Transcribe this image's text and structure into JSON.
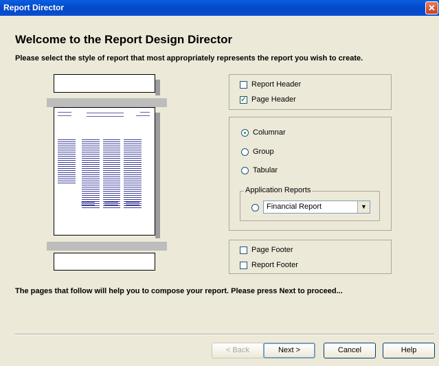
{
  "window": {
    "title": "Report Director",
    "close_icon": "close-icon"
  },
  "header": {
    "title": "Welcome to the Report Design Director",
    "subtitle": "Please select the style of report that most appropriately represents the report you wish to create."
  },
  "header_options": [
    {
      "label": "Report Header",
      "checked": false
    },
    {
      "label": "Page Header",
      "checked": true
    }
  ],
  "style_options": [
    {
      "label": "Columnar",
      "selected": true
    },
    {
      "label": "Group",
      "selected": false
    },
    {
      "label": "Tabular",
      "selected": false
    }
  ],
  "app_reports": {
    "legend": "Application Reports",
    "selected": false,
    "dropdown_value": "Financial Report"
  },
  "footer_options": [
    {
      "label": "Page Footer",
      "checked": false
    },
    {
      "label": "Report Footer",
      "checked": false
    }
  ],
  "footer_text": "The pages that follow will help you to compose your report.  Please press Next to proceed...",
  "buttons": {
    "back": "< Back",
    "next": "Next >",
    "cancel": "Cancel",
    "help": "Help"
  }
}
